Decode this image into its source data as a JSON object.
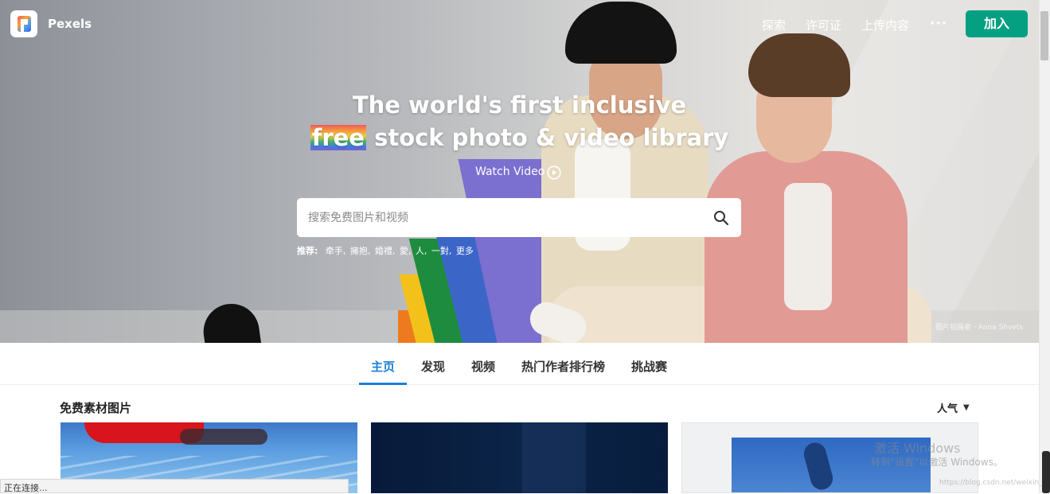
{
  "header": {
    "brand": "Pexels",
    "nav": [
      "探索",
      "许可证",
      "上传内容"
    ],
    "more": "···",
    "join_label": "加入"
  },
  "hero": {
    "headline_line1": "The world's first inclusive",
    "headline_free": "free",
    "headline_line2_rest": " stock photo & video library",
    "watch_video": "Watch Video",
    "search_placeholder": "搜索免费图片和视频",
    "suggest_label": "推荐:",
    "suggestions": [
      "牵手,",
      "擁抱,",
      "婚禮,",
      "愛,",
      "人,",
      "一對,",
      "更多"
    ],
    "photo_credit": "图片拍摄者 · Anna Shvets"
  },
  "tabs": [
    "主页",
    "发现",
    "视频",
    "热门作者排行榜",
    "挑战赛"
  ],
  "active_tab": "主页",
  "section": {
    "title": "免费素材图片",
    "sort_label": "人气"
  },
  "browser": {
    "status": "正在连接...",
    "watermark_line1": "激活 Windows",
    "watermark_line2": "转到“设置”以激活 Windows。",
    "url_watermark": "https://blog.csdn.net/weixin_..."
  },
  "colors": {
    "accent": "#05a081",
    "tab_active": "#1a7fd8"
  }
}
